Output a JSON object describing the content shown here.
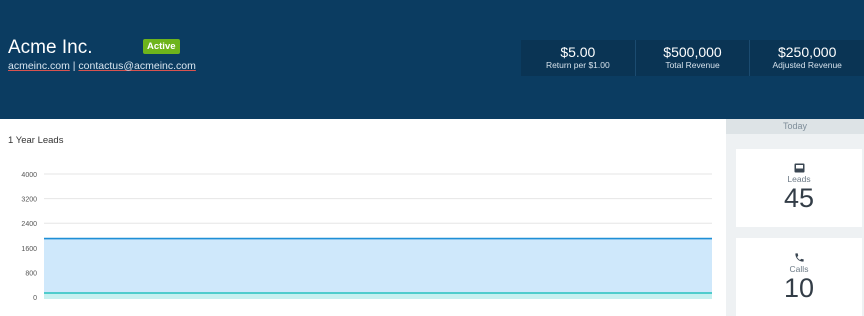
{
  "company": {
    "name": "Acme Inc.",
    "status": "Active",
    "website": "acmeinc.com",
    "separator": " | ",
    "email": "contactus@acmeinc.com"
  },
  "stats": [
    {
      "value": "$5.00",
      "label": "Return per $1.00"
    },
    {
      "value": "$500,000",
      "label": "Total Revenue"
    },
    {
      "value": "$250,000",
      "label": "Adjusted Revenue"
    }
  ],
  "chart_data": {
    "type": "area",
    "title": "1 Year Leads",
    "xlabel": "",
    "ylabel": "",
    "ylim": [
      0,
      4000
    ],
    "yticks": [
      "4000",
      "3200",
      "2400",
      "1600",
      "800",
      "0"
    ],
    "grid": true,
    "series": [
      {
        "values": [
          1900,
          1900
        ],
        "color": "#1f8fd6",
        "fill": "#cfe8fb"
      },
      {
        "values": [
          130,
          130
        ],
        "color": "#26c1c0",
        "fill": "#c6f0f0"
      }
    ]
  },
  "today": {
    "header": "Today",
    "leads": {
      "label": "Leads",
      "value": "45",
      "icon": "inbox-icon"
    },
    "calls": {
      "label": "Calls",
      "value": "10",
      "icon": "phone-icon"
    }
  }
}
